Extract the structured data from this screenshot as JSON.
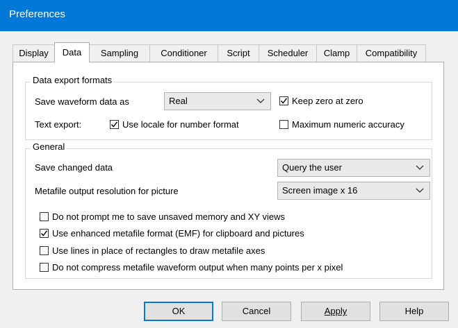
{
  "window": {
    "title": "Preferences"
  },
  "tabs": [
    {
      "label": "Display"
    },
    {
      "label": "Data"
    },
    {
      "label": "Sampling"
    },
    {
      "label": "Conditioner"
    },
    {
      "label": "Script"
    },
    {
      "label": "Scheduler"
    },
    {
      "label": "Clamp"
    },
    {
      "label": "Compatibility"
    }
  ],
  "active_tab": "Data",
  "data_export": {
    "group_title": "Data export formats",
    "save_waveform_label": "Save waveform data as",
    "save_waveform_value": "Real",
    "keep_zero": {
      "label": "Keep zero at zero",
      "checked": true
    },
    "text_export_label": "Text export:",
    "use_locale": {
      "label": "Use locale for number format",
      "checked": true
    },
    "max_accuracy": {
      "label": "Maximum numeric accuracy",
      "checked": false
    }
  },
  "general": {
    "group_title": "General",
    "save_changed_label": "Save changed data",
    "save_changed_value": "Query the user",
    "metafile_res_label": "Metafile output resolution for picture",
    "metafile_res_value": "Screen image x 16",
    "options": [
      {
        "label": "Do not prompt me to save unsaved memory and XY views",
        "checked": false
      },
      {
        "label": "Use enhanced metafile format (EMF) for clipboard and pictures",
        "checked": true
      },
      {
        "label": "Use lines in place of rectangles to draw metafile axes",
        "checked": false
      },
      {
        "label": "Do not compress metafile waveform output when many points per x pixel",
        "checked": false
      }
    ]
  },
  "buttons": {
    "ok": "OK",
    "cancel": "Cancel",
    "apply": "Apply",
    "help": "Help"
  },
  "colors": {
    "titlebar": "#0078d7",
    "dialog_bg": "#f0f0f0",
    "panel_bg": "#ffffff",
    "focus_border": "#0078d7"
  }
}
